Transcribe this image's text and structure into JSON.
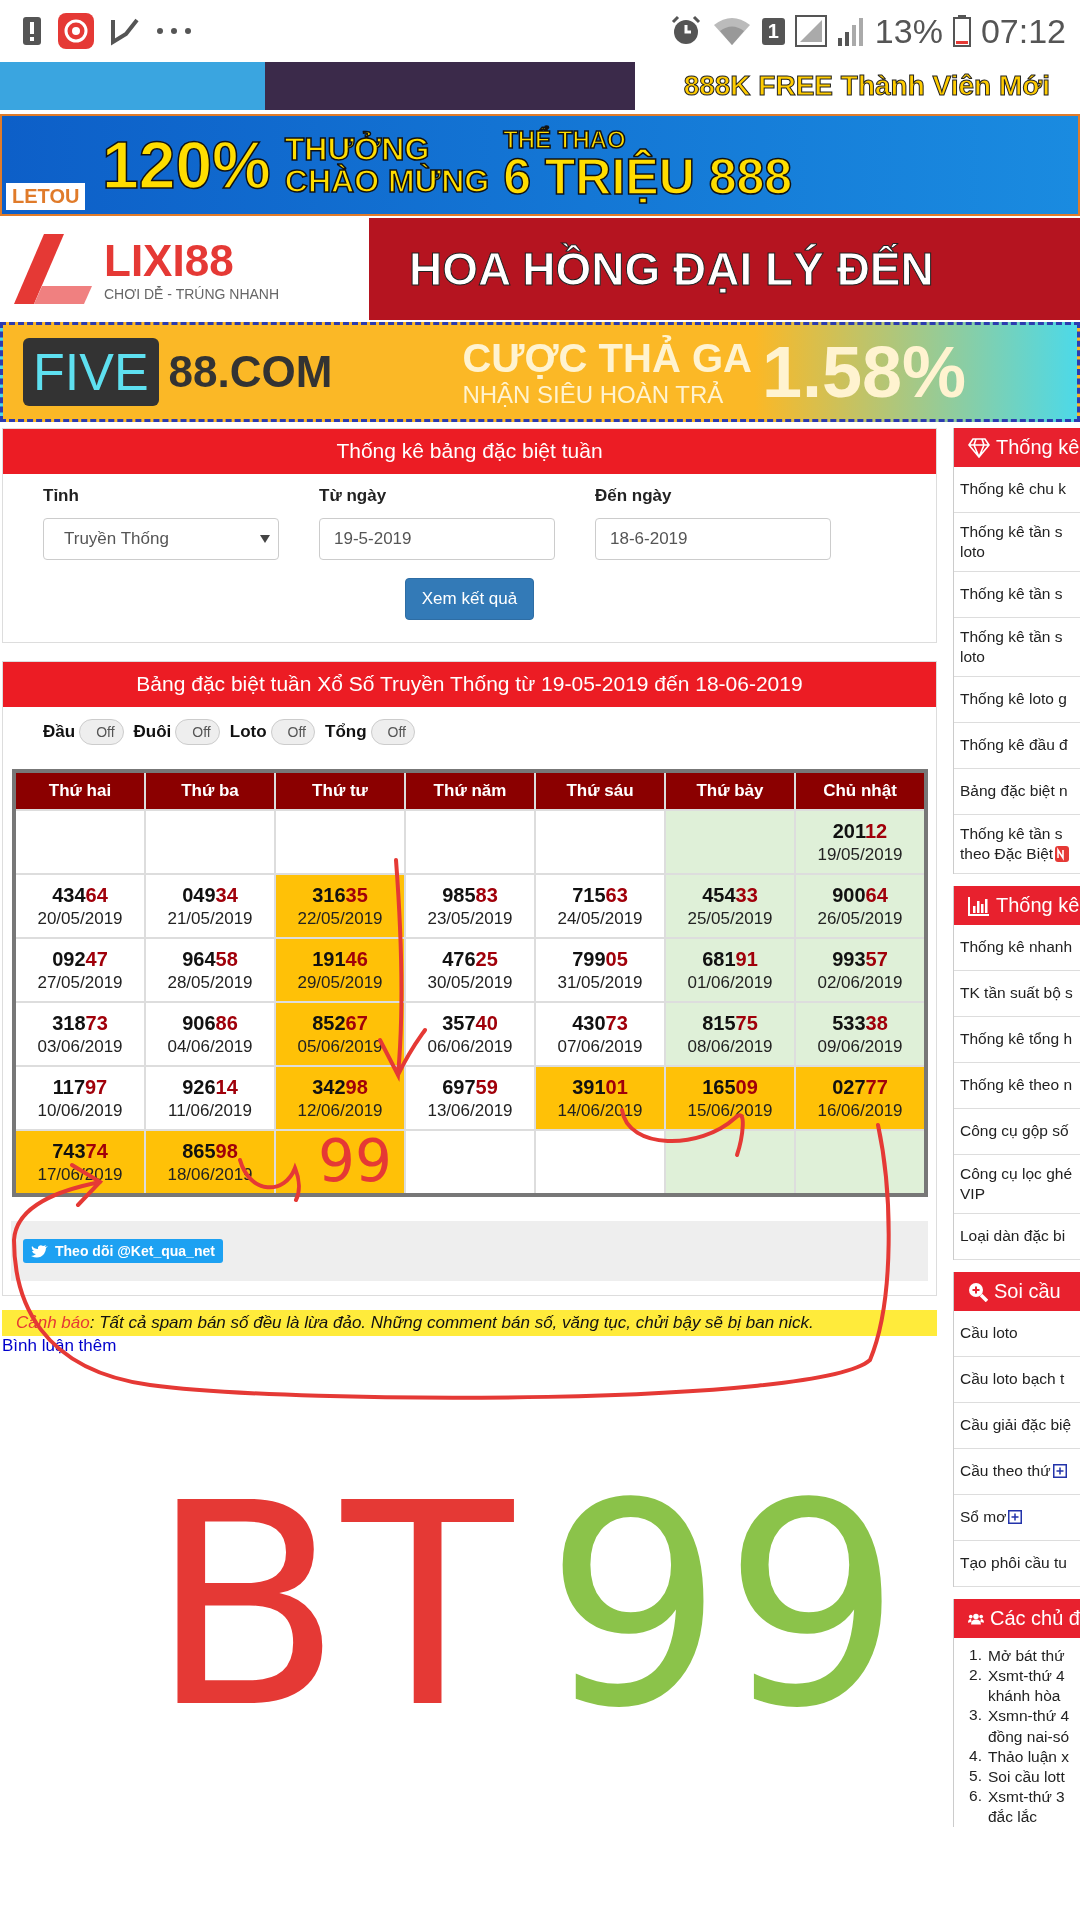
{
  "status_bar": {
    "sim": "1",
    "battery": "13%",
    "time": "07:12"
  },
  "banners": [
    {
      "kind": "fun88",
      "texts": [
        "888K FREE Thành Viên Mới"
      ]
    },
    {
      "kind": "letou",
      "texts": [
        "LETOU",
        "120%",
        "THƯỞNG",
        "CHÀO MỪNG",
        "THỂ THAO",
        "6 TRIỆU 888"
      ]
    },
    {
      "kind": "lixi",
      "texts": [
        "LIXI88",
        "CHƠI DỄ - TRÚNG NHANH",
        "HOA HỒNG ĐẠI LÝ ĐẾN"
      ]
    },
    {
      "kind": "five",
      "texts": [
        "FIVE",
        "88.COM",
        "CƯỢC THẢ GA",
        "NHẬN SIÊU HOÀN TRẢ",
        "1.58%"
      ]
    }
  ],
  "form": {
    "title": "Thống kê bảng đặc biệt tuần",
    "fields": [
      {
        "kind": "select",
        "label": "Tỉnh",
        "value": "Truyền Thống"
      },
      {
        "kind": "input",
        "label": "Từ ngày",
        "value": "19-5-2019"
      },
      {
        "kind": "input",
        "label": "Đến ngày",
        "value": "18-6-2019"
      }
    ],
    "button": "Xem kết quả"
  },
  "results": {
    "title": "Bảng đặc biệt tuần Xổ Số Truyền Thống từ 19-05-2019 đến 18-06-2019",
    "toggles": [
      {
        "label": "Đầu",
        "state": "Off",
        "on": false
      },
      {
        "label": "Đuôi",
        "state": "Off",
        "on": false
      },
      {
        "label": "Loto",
        "state": "Off",
        "on": false
      },
      {
        "label": "Tổng",
        "state": "Off",
        "on": false
      }
    ],
    "columns": [
      "Thứ hai",
      "Thứ ba",
      "Thứ tư",
      "Thứ năm",
      "Thứ sáu",
      "Thứ bảy",
      "Chủ nhật"
    ],
    "rows": [
      [
        {
          "kind": "plain"
        },
        {
          "kind": "plain"
        },
        {
          "kind": "plain"
        },
        {
          "kind": "plain"
        },
        {
          "kind": "plain"
        },
        {
          "kind": "weekend"
        },
        {
          "kind": "weekend",
          "head": "201",
          "tail": "12",
          "date": "19/05/2019"
        }
      ],
      [
        {
          "kind": "plain",
          "head": "434",
          "tail": "64",
          "date": "20/05/2019"
        },
        {
          "kind": "plain",
          "head": "049",
          "tail": "34",
          "date": "21/05/2019"
        },
        {
          "kind": "highlight",
          "head": "316",
          "tail": "35",
          "date": "22/05/2019"
        },
        {
          "kind": "plain",
          "head": "985",
          "tail": "83",
          "date": "23/05/2019"
        },
        {
          "kind": "plain",
          "head": "715",
          "tail": "63",
          "date": "24/05/2019"
        },
        {
          "kind": "weekend",
          "head": "454",
          "tail": "33",
          "date": "25/05/2019"
        },
        {
          "kind": "weekend",
          "head": "900",
          "tail": "64",
          "date": "26/05/2019"
        }
      ],
      [
        {
          "kind": "plain",
          "head": "092",
          "tail": "47",
          "date": "27/05/2019"
        },
        {
          "kind": "plain",
          "head": "964",
          "tail": "58",
          "date": "28/05/2019"
        },
        {
          "kind": "highlight",
          "head": "191",
          "tail": "46",
          "date": "29/05/2019"
        },
        {
          "kind": "plain",
          "head": "476",
          "tail": "25",
          "date": "30/05/2019"
        },
        {
          "kind": "plain",
          "head": "799",
          "tail": "05",
          "date": "31/05/2019"
        },
        {
          "kind": "weekend",
          "head": "681",
          "tail": "91",
          "date": "01/06/2019"
        },
        {
          "kind": "weekend",
          "head": "993",
          "tail": "57",
          "date": "02/06/2019"
        }
      ],
      [
        {
          "kind": "plain",
          "head": "318",
          "tail": "73",
          "date": "03/06/2019"
        },
        {
          "kind": "plain",
          "head": "906",
          "tail": "86",
          "date": "04/06/2019"
        },
        {
          "kind": "highlight",
          "head": "852",
          "tail": "67",
          "date": "05/06/2019"
        },
        {
          "kind": "plain",
          "head": "357",
          "tail": "40",
          "date": "06/06/2019"
        },
        {
          "kind": "plain",
          "head": "430",
          "tail": "73",
          "date": "07/06/2019"
        },
        {
          "kind": "weekend",
          "head": "815",
          "tail": "75",
          "date": "08/06/2019"
        },
        {
          "kind": "weekend",
          "head": "533",
          "tail": "38",
          "date": "09/06/2019"
        }
      ],
      [
        {
          "kind": "plain",
          "head": "117",
          "tail": "97",
          "date": "10/06/2019"
        },
        {
          "kind": "plain",
          "head": "926",
          "tail": "14",
          "date": "11/06/2019"
        },
        {
          "kind": "highlight",
          "head": "342",
          "tail": "98",
          "date": "12/06/2019"
        },
        {
          "kind": "plain",
          "head": "697",
          "tail": "59",
          "date": "13/06/2019"
        },
        {
          "kind": "highlight",
          "head": "391",
          "tail": "01",
          "date": "14/06/2019"
        },
        {
          "kind": "highlight",
          "head": "165",
          "tail": "09",
          "date": "15/06/2019"
        },
        {
          "kind": "highlight",
          "head": "027",
          "tail": "77",
          "date": "16/06/2019"
        }
      ],
      [
        {
          "kind": "highlight",
          "head": "743",
          "tail": "74",
          "date": "17/06/2019"
        },
        {
          "kind": "highlight",
          "head": "865",
          "tail": "98",
          "date": "18/06/2019"
        },
        {
          "kind": "highlight"
        },
        {
          "kind": "plain"
        },
        {
          "kind": "plain"
        },
        {
          "kind": "weekend"
        },
        {
          "kind": "weekend"
        }
      ]
    ],
    "follow_button": "Theo dõi @Ket_qua_net"
  },
  "warning": {
    "label": "Cảnh báo",
    "text": ": Tất cả spam bán số đều là lừa đảo. Những comment bán số, văng tục, chửi bậy sẽ bị ban nick."
  },
  "more_comments_link": "Bình luận thêm",
  "sidebar": [
    {
      "title": "Thống kê",
      "items": [
        {
          "lines": [
            "Thống kê chu k"
          ]
        },
        {
          "lines": [
            "Thống kê tần s",
            "loto"
          ]
        },
        {
          "lines": [
            "Thống kê tần s"
          ]
        },
        {
          "lines": [
            "Thống kê tần s",
            "loto"
          ]
        },
        {
          "lines": [
            "Thống kê loto g"
          ]
        },
        {
          "lines": [
            "Thống kê đầu đ"
          ]
        },
        {
          "lines": [
            "Bảng đặc biệt n"
          ]
        },
        {
          "lines": [
            "Thống kê tần s",
            "theo Đặc Biệt"
          ],
          "new": true
        }
      ]
    },
    {
      "title": "Thống kê",
      "items": [
        {
          "lines": [
            "Thống kê nhanh"
          ]
        },
        {
          "lines": [
            "TK tần suất bộ s"
          ]
        },
        {
          "lines": [
            "Thống kê tổng h"
          ]
        },
        {
          "lines": [
            "Thống kê theo n"
          ]
        },
        {
          "lines": [
            "Công cụ gộp số"
          ]
        },
        {
          "lines": [
            "Công cụ lọc ghé",
            "VIP"
          ]
        },
        {
          "lines": [
            "Loại dàn đặc bi"
          ]
        }
      ]
    },
    {
      "title": "Soi cầu",
      "items": [
        {
          "lines": [
            "Cầu loto"
          ]
        },
        {
          "lines": [
            "Cầu loto bạch t"
          ]
        },
        {
          "lines": [
            "Cầu giải đặc biệ"
          ]
        },
        {
          "lines": [
            "Cầu theo thứ"
          ],
          "expandable": true
        },
        {
          "lines": [
            "Sổ mơ"
          ],
          "expandable": true
        },
        {
          "lines": [
            "Tạo phôi cầu tu"
          ]
        }
      ]
    },
    {
      "title": "Các chủ đ",
      "topics": [
        {
          "number": "1.",
          "lines": [
            "Mở bát thứ"
          ]
        },
        {
          "number": "2.",
          "lines": [
            "Xsmt-thứ 4",
            "khánh hòa"
          ]
        },
        {
          "number": "3.",
          "lines": [
            "Xsmn-thứ 4",
            "đồng nai-só"
          ]
        },
        {
          "number": "4.",
          "lines": [
            "Thảo luận x"
          ]
        },
        {
          "number": "5.",
          "lines": [
            "Soi cầu lott"
          ]
        },
        {
          "number": "6.",
          "lines": [
            "Xsmt-thứ 3",
            "đắc lắc"
          ]
        }
      ]
    }
  ],
  "handwriting": [
    {
      "text": "99",
      "color": "#e53935"
    },
    {
      "text": "BT",
      "color": "#e53935"
    },
    {
      "text": "99",
      "color": "#8bc34a"
    }
  ]
}
